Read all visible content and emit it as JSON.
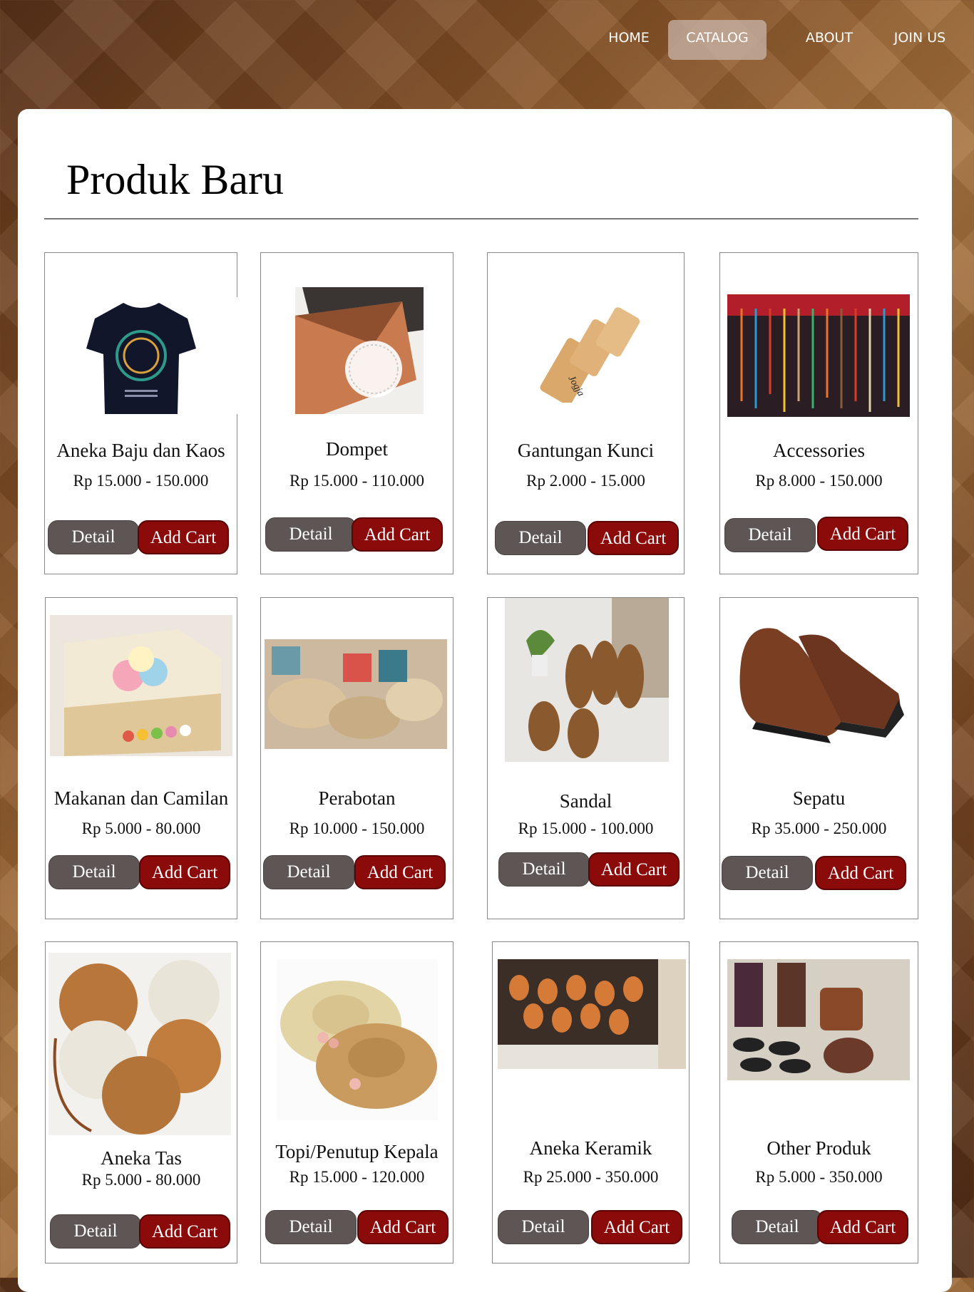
{
  "nav": {
    "items": [
      {
        "label": "HOME"
      },
      {
        "label": "CATALOG"
      },
      {
        "label": "ABOUT"
      },
      {
        "label": "JOIN US"
      }
    ]
  },
  "page": {
    "title": "Produk Baru"
  },
  "products": [
    {
      "name": "Aneka Baju dan Kaos",
      "price": "Rp 15.000 - 150.000",
      "detail_label": "Detail",
      "cart_label": "Add Cart",
      "image": "tshirt-image"
    },
    {
      "name": "Dompet",
      "price": "Rp 15.000 - 110.000",
      "detail_label": "Detail",
      "cart_label": "Add Cart",
      "image": "wallet-image"
    },
    {
      "name": "Gantungan Kunci",
      "price": "Rp 2.000 - 15.000",
      "detail_label": "Detail",
      "cart_label": "Add Cart",
      "image": "keychain-image",
      "image_text": "Jogja"
    },
    {
      "name": "Accessories",
      "price": "Rp 8.000 - 150.000",
      "detail_label": "Detail",
      "cart_label": "Add Cart",
      "image": "accessories-image"
    },
    {
      "name": "Makanan dan Camilan",
      "price": "Rp 5.000 - 80.000",
      "detail_label": "Detail",
      "cart_label": "Add Cart",
      "image": "snack-box-image"
    },
    {
      "name": "Perabotan",
      "price": "Rp 10.000 - 150.000",
      "detail_label": "Detail",
      "cart_label": "Add Cart",
      "image": "furnishing-image"
    },
    {
      "name": "Sandal",
      "price": "Rp 15.000 - 100.000",
      "detail_label": "Detail",
      "cart_label": "Add Cart",
      "image": "sandal-image"
    },
    {
      "name": "Sepatu",
      "price": "Rp 35.000 - 250.000",
      "detail_label": "Detail",
      "cart_label": "Add Cart",
      "image": "shoes-image"
    },
    {
      "name": "Aneka Tas",
      "price": "Rp 5.000 - 80.000",
      "detail_label": "Detail",
      "cart_label": "Add Cart",
      "image": "rattan-bag-image"
    },
    {
      "name": "Topi/Penutup Kepala",
      "price": "Rp 15.000 - 120.000",
      "detail_label": "Detail",
      "cart_label": "Add Cart",
      "image": "hat-image"
    },
    {
      "name": "Aneka Keramik",
      "price": "Rp 25.000 - 350.000",
      "detail_label": "Detail",
      "cart_label": "Add Cart",
      "image": "ceramics-image"
    },
    {
      "name": "Other Produk",
      "price": "Rp 5.000 - 350.000",
      "detail_label": "Detail",
      "cart_label": "Add Cart",
      "image": "other-products-image"
    }
  ],
  "colors": {
    "detail_button": "#5e5555",
    "cart_button": "#8b0b0b",
    "nav_active": "#c8b4aa"
  }
}
